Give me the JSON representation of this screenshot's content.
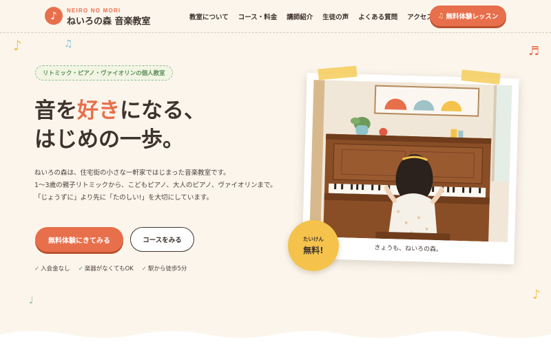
{
  "header": {
    "logo_en": "NEIRO NO MORI",
    "logo_ja": "ねいろの森 音楽教室",
    "logo_icon": "music-note-icon",
    "nav": [
      "教室について",
      "コース・料金",
      "講師紹介",
      "生徒の声",
      "よくある質問",
      "アクセス"
    ],
    "cta_label": "無料体験レッスン",
    "cta_icon": "music-note-icon"
  },
  "hero": {
    "tagline": "リトミック・ピアノ・ヴァイオリンの個人教室",
    "headline_line1_a": "音を",
    "headline_line1_accent": "好き",
    "headline_line1_b": "になる、",
    "headline_line2": "はじめの一歩。",
    "lead_1": "ねいろの森は、住宅街の小さな一軒家ではじまった音楽教室です。",
    "lead_2": "1〜3歳の親子リトミックから、こどもピアノ、大人のピアノ、ヴァイオリンまで。",
    "lead_3": "「じょうずに」より先に「たのしい!」を大切にしています。",
    "primary_button": "無料体験にきてみる",
    "secondary_button": "コースをみる",
    "perks": [
      "入会金なし",
      "楽器がなくてもOK",
      "駅から徒歩5分"
    ]
  },
  "photo": {
    "caption": "きょうも、ねいろの森。",
    "badge_small": "たいけん",
    "badge_big": "無料!"
  },
  "decor": {
    "note_glyphs": [
      "♪",
      "♫",
      "♬",
      "♩",
      "♪"
    ]
  },
  "colors": {
    "background": "#fbf5ec",
    "accent": "#e86f4b",
    "green": "#8cbf8a",
    "yellow": "#f5c34b",
    "text": "#3e332d"
  }
}
